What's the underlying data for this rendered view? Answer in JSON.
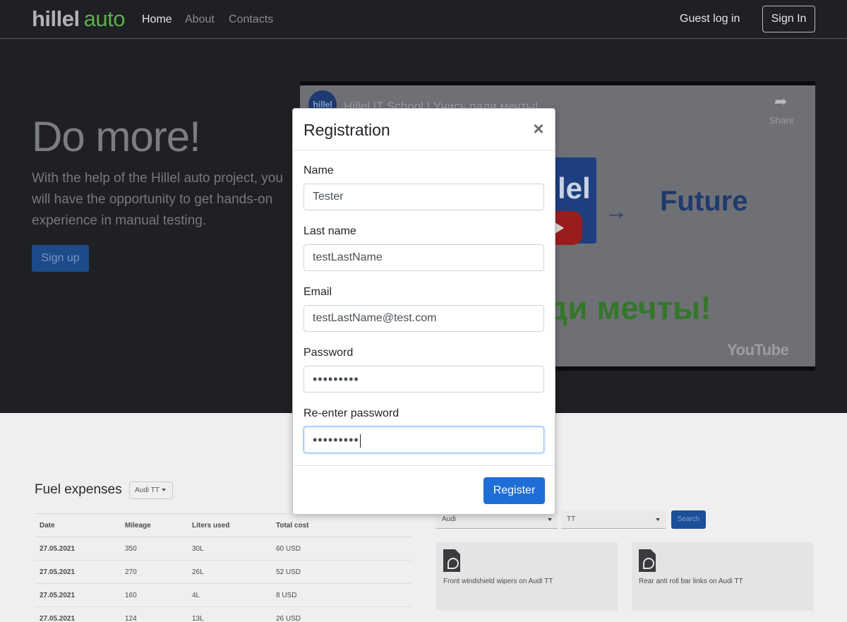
{
  "header": {
    "logo_part1": "hillel",
    "logo_part2": "auto",
    "nav": [
      "Home",
      "About",
      "Contacts"
    ],
    "guest_login": "Guest log in",
    "sign_in": "Sign In"
  },
  "hero": {
    "title": "Do more!",
    "text": "With the help of the Hillel auto project, you will have the opportunity to get hands-on experience in manual testing.",
    "sign_up": "Sign up"
  },
  "video": {
    "channel_logo": "hillel",
    "title": "Hillel IT School | Учись ради мечты!",
    "share_icon": "share-icon",
    "share": "Share",
    "badge_text": "lel",
    "arrow": "→",
    "future": "Future",
    "slogan": "ди мечты!",
    "youtube": "YouTube"
  },
  "fuel": {
    "title": "Fuel expenses",
    "car": "Audi TT",
    "columns": [
      "Date",
      "Mileage",
      "Liters used",
      "Total cost"
    ],
    "rows": [
      [
        "27.05.2021",
        "350",
        "30L",
        "60 USD"
      ],
      [
        "27.05.2021",
        "270",
        "26L",
        "52 USD"
      ],
      [
        "27.05.2021",
        "160",
        "4L",
        "8 USD"
      ],
      [
        "27.05.2021",
        "124",
        "13L",
        "26 USD"
      ]
    ]
  },
  "instructions": {
    "brand": "Audi",
    "model": "TT",
    "search": "Search",
    "cards": [
      {
        "icon": "pdf-icon",
        "text": "Front windshield wipers on Audi TT"
      },
      {
        "icon": "pdf-icon",
        "text": "Rear anti roll bar links on Audi TT"
      }
    ]
  },
  "modal": {
    "title": "Registration",
    "close": "×",
    "fields": {
      "name": {
        "label": "Name",
        "value": "Tester"
      },
      "last_name": {
        "label": "Last name",
        "value": "testLastName"
      },
      "email": {
        "label": "Email",
        "value": "testLastName@test.com"
      },
      "password": {
        "label": "Password",
        "value": "•••••••••"
      },
      "repeat_password": {
        "label": "Re-enter password",
        "value": "•••••••••"
      }
    },
    "register": "Register"
  },
  "colors": {
    "header_bg": "#1f2023",
    "logo_accent": "#5bb04e",
    "primary": "#1e6ed6"
  }
}
